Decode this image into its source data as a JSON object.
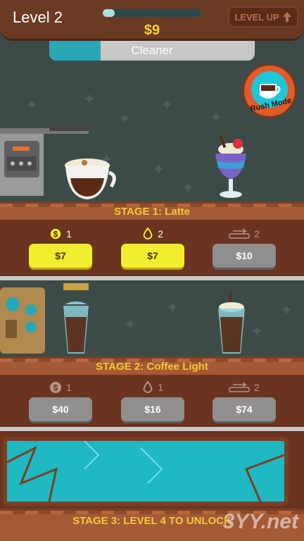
{
  "header": {
    "level": "Level 2",
    "money": "$9",
    "xp_progress": 0.12,
    "level_up_label": "LEVEL UP"
  },
  "manager": {
    "name": "Cleaner",
    "progress": 0.25
  },
  "rush_mode": {
    "label": "Rush Mode"
  },
  "stages": [
    {
      "title": "STAGE 1: Latte",
      "upgrades": [
        {
          "icon": "coin-icon",
          "level": "1",
          "price": "$7",
          "state": "affordable"
        },
        {
          "icon": "drop-icon",
          "level": "2",
          "price": "$7",
          "state": "affordable"
        },
        {
          "icon": "conveyor-icon",
          "level": "2",
          "price": "$10",
          "state": "locked"
        }
      ]
    },
    {
      "title": "STAGE 2: Coffee Light",
      "upgrades": [
        {
          "icon": "coin-icon",
          "level": "1",
          "price": "$40",
          "state": "locked"
        },
        {
          "icon": "drop-icon",
          "level": "1",
          "price": "$16",
          "state": "locked"
        },
        {
          "icon": "conveyor-icon",
          "level": "2",
          "price": "$74",
          "state": "locked"
        }
      ]
    },
    {
      "title": "STAGE 3: LEVEL 4 TO UNLOCK"
    }
  ],
  "watermark": "3YY.net",
  "colors": {
    "accent": "#f7c83a",
    "button_yellow": "#f1ee30",
    "button_gray": "#8f8f8f",
    "wood": "#6a3420"
  }
}
